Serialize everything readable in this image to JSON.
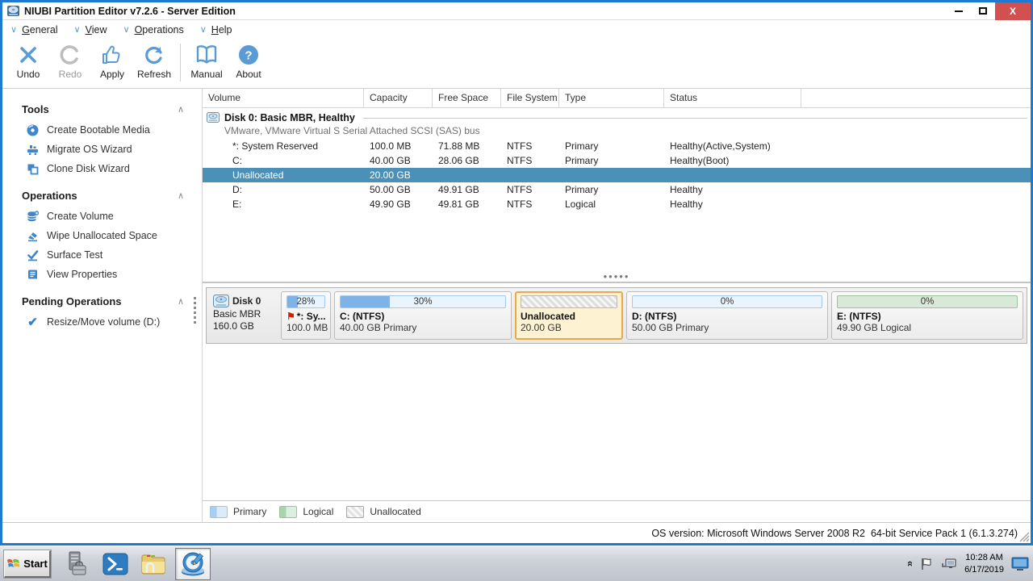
{
  "window": {
    "title": "NIUBI Partition Editor v7.2.6 - Server Edition",
    "close_glyph": "X"
  },
  "menu": {
    "items": [
      {
        "label": "General"
      },
      {
        "label": "View"
      },
      {
        "label": "Operations"
      },
      {
        "label": "Help"
      }
    ]
  },
  "toolbar": {
    "undo": "Undo",
    "redo": "Redo",
    "apply": "Apply",
    "refresh": "Refresh",
    "manual": "Manual",
    "about": "About"
  },
  "sidebar": {
    "tools": {
      "header": "Tools",
      "items": [
        "Create Bootable Media",
        "Migrate OS Wizard",
        "Clone Disk Wizard"
      ]
    },
    "operations": {
      "header": "Operations",
      "items": [
        "Create Volume",
        "Wipe Unallocated Space",
        "Surface Test",
        "View Properties"
      ]
    },
    "pending": {
      "header": "Pending Operations",
      "items": [
        "Resize/Move volume (D:)"
      ]
    }
  },
  "table": {
    "columns": [
      "Volume",
      "Capacity",
      "Free Space",
      "File System",
      "Type",
      "Status"
    ],
    "disk_group": {
      "title": "Disk 0: Basic MBR, Healthy",
      "subtitle": "VMware, VMware Virtual S Serial Attached SCSI (SAS) bus"
    },
    "rows": [
      {
        "volume": "*: System Reserved",
        "capacity": "100.0 MB",
        "free": "71.88 MB",
        "fs": "NTFS",
        "type": "Primary",
        "status": "Healthy(Active,System)"
      },
      {
        "volume": "C:",
        "capacity": "40.00 GB",
        "free": "28.06 GB",
        "fs": "NTFS",
        "type": "Primary",
        "status": "Healthy(Boot)"
      },
      {
        "volume": "Unallocated",
        "capacity": "20.00 GB",
        "free": "",
        "fs": "",
        "type": "",
        "status": ""
      },
      {
        "volume": "D:",
        "capacity": "50.00 GB",
        "free": "49.91 GB",
        "fs": "NTFS",
        "type": "Primary",
        "status": "Healthy"
      },
      {
        "volume": "E:",
        "capacity": "49.90 GB",
        "free": "49.81 GB",
        "fs": "NTFS",
        "type": "Logical",
        "status": "Healthy"
      }
    ]
  },
  "disk_map": {
    "disk": {
      "name": "Disk 0",
      "scheme": "Basic MBR",
      "size": "160.0 GB"
    },
    "blocks": [
      {
        "percent": "28%",
        "fill": 28,
        "label": "*: Sy...",
        "size": "100.0 MB"
      },
      {
        "percent": "30%",
        "fill": 30,
        "label": "C: (NTFS)",
        "size": "40.00 GB Primary"
      },
      {
        "percent": "",
        "label": "Unallocated",
        "size": "20.00 GB"
      },
      {
        "percent": "0%",
        "fill": 0,
        "label": "D: (NTFS)",
        "size": "50.00 GB Primary"
      },
      {
        "percent": "0%",
        "fill": 0,
        "label": "E: (NTFS)",
        "size": "49.90 GB Logical"
      }
    ]
  },
  "legend": {
    "items": [
      "Primary",
      "Logical",
      "Unallocated"
    ]
  },
  "status_bar": {
    "text": "OS version: Microsoft Windows Server 2008 R2  64-bit Service Pack 1 (6.1.3.274)"
  },
  "taskbar": {
    "start": "Start",
    "clock": {
      "time": "10:28 AM",
      "date": "6/17/2019"
    }
  },
  "colors": {
    "window_border": "#1e7ad0",
    "accent_blue": "#5b9bd5",
    "selection_blue": "#4b90b7",
    "close_red": "#d25050",
    "unallocated_selected_border": "#e8aa46",
    "primary_bar_fill": "#7fb3e8",
    "logical_green": "#a9d3ae"
  }
}
